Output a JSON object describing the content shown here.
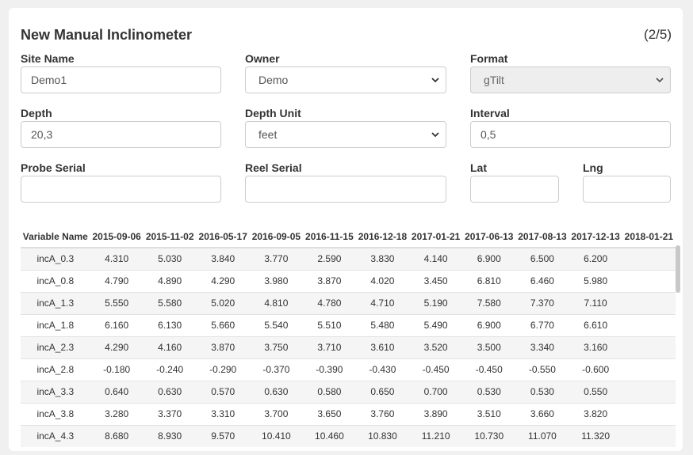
{
  "form": {
    "title": "New Manual Inclinometer",
    "step": "(2/5)",
    "site_name": {
      "label": "Site Name",
      "value": "Demo1"
    },
    "owner": {
      "label": "Owner",
      "value": "Demo"
    },
    "format": {
      "label": "Format",
      "value": "gTilt"
    },
    "depth": {
      "label": "Depth",
      "value": "20,3"
    },
    "depth_unit": {
      "label": "Depth Unit",
      "value": "feet"
    },
    "interval": {
      "label": "Interval",
      "value": "0,5"
    },
    "probe_serial": {
      "label": "Probe Serial",
      "value": ""
    },
    "reel_serial": {
      "label": "Reel Serial",
      "value": ""
    },
    "lat": {
      "label": "Lat",
      "value": ""
    },
    "lng": {
      "label": "Lng",
      "value": ""
    }
  },
  "table": {
    "headers": [
      "Variable Name",
      "2015-09-06",
      "2015-11-02",
      "2016-05-17",
      "2016-09-05",
      "2016-11-15",
      "2016-12-18",
      "2017-01-21",
      "2017-06-13",
      "2017-08-13",
      "2017-12-13",
      "2018-01-21"
    ],
    "rows": [
      [
        "incA_0.3",
        "4.310",
        "5.030",
        "3.840",
        "3.770",
        "2.590",
        "3.830",
        "4.140",
        "6.900",
        "6.500",
        "6.200",
        ""
      ],
      [
        "incA_0.8",
        "4.790",
        "4.890",
        "4.290",
        "3.980",
        "3.870",
        "4.020",
        "3.450",
        "6.810",
        "6.460",
        "5.980",
        ""
      ],
      [
        "incA_1.3",
        "5.550",
        "5.580",
        "5.020",
        "4.810",
        "4.780",
        "4.710",
        "5.190",
        "7.580",
        "7.370",
        "7.110",
        ""
      ],
      [
        "incA_1.8",
        "6.160",
        "6.130",
        "5.660",
        "5.540",
        "5.510",
        "5.480",
        "5.490",
        "6.900",
        "6.770",
        "6.610",
        ""
      ],
      [
        "incA_2.3",
        "4.290",
        "4.160",
        "3.870",
        "3.750",
        "3.710",
        "3.610",
        "3.520",
        "3.500",
        "3.340",
        "3.160",
        ""
      ],
      [
        "incA_2.8",
        "-0.180",
        "-0.240",
        "-0.290",
        "-0.370",
        "-0.390",
        "-0.430",
        "-0.450",
        "-0.450",
        "-0.550",
        "-0.600",
        ""
      ],
      [
        "incA_3.3",
        "0.640",
        "0.630",
        "0.570",
        "0.630",
        "0.580",
        "0.650",
        "0.700",
        "0.530",
        "0.530",
        "0.550",
        ""
      ],
      [
        "incA_3.8",
        "3.280",
        "3.370",
        "3.310",
        "3.700",
        "3.650",
        "3.760",
        "3.890",
        "3.510",
        "3.660",
        "3.820",
        ""
      ],
      [
        "incA_4.3",
        "8.680",
        "8.930",
        "9.570",
        "10.410",
        "10.460",
        "10.830",
        "11.210",
        "10.730",
        "11.070",
        "11.320",
        ""
      ]
    ]
  }
}
